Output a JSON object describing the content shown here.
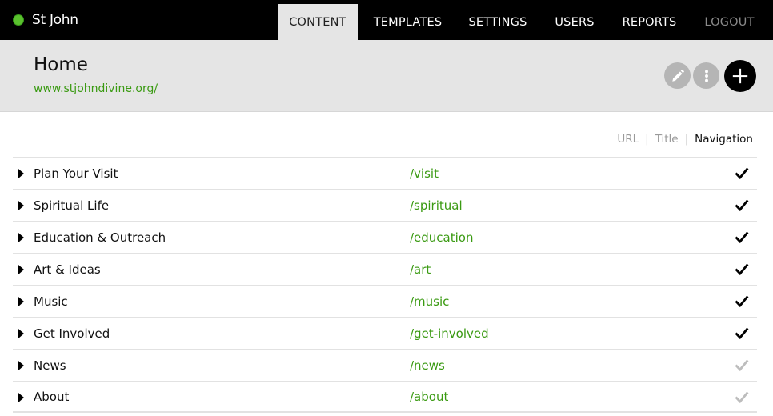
{
  "app": {
    "name": "St John",
    "status_color": "#5ac12e"
  },
  "nav": {
    "items": [
      {
        "label": "CONTENT",
        "active": true
      },
      {
        "label": "TEMPLATES",
        "active": false
      },
      {
        "label": "SETTINGS",
        "active": false
      },
      {
        "label": "USERS",
        "active": false
      },
      {
        "label": "REPORTS",
        "active": false
      },
      {
        "label": "LOGOUT",
        "active": false,
        "muted": true
      }
    ]
  },
  "page": {
    "title": "Home",
    "url": "www.stjohndivine.org/",
    "actions": {
      "edit_icon": "pencil-icon",
      "more_icon": "vertical-dots-icon",
      "add_icon": "plus-icon"
    }
  },
  "view_toggle": {
    "options": [
      "URL",
      "Title",
      "Navigation"
    ],
    "separator": "|",
    "active": "Navigation"
  },
  "colors": {
    "accent_green": "#3a9a12",
    "check_active": "#000000",
    "check_inactive": "#bdbdbd"
  },
  "rows": [
    {
      "title": "Plan Your Visit",
      "path": "/visit",
      "in_navigation": true
    },
    {
      "title": "Spiritual Life",
      "path": "/spiritual",
      "in_navigation": true
    },
    {
      "title": "Education & Outreach",
      "path": "/education",
      "in_navigation": true
    },
    {
      "title": "Art & Ideas",
      "path": "/art",
      "in_navigation": true
    },
    {
      "title": "Music",
      "path": "/music",
      "in_navigation": true
    },
    {
      "title": "Get Involved",
      "path": "/get-involved",
      "in_navigation": true
    },
    {
      "title": "News",
      "path": "/news",
      "in_navigation": false
    },
    {
      "title": "About",
      "path": "/about",
      "in_navigation": false
    }
  ]
}
